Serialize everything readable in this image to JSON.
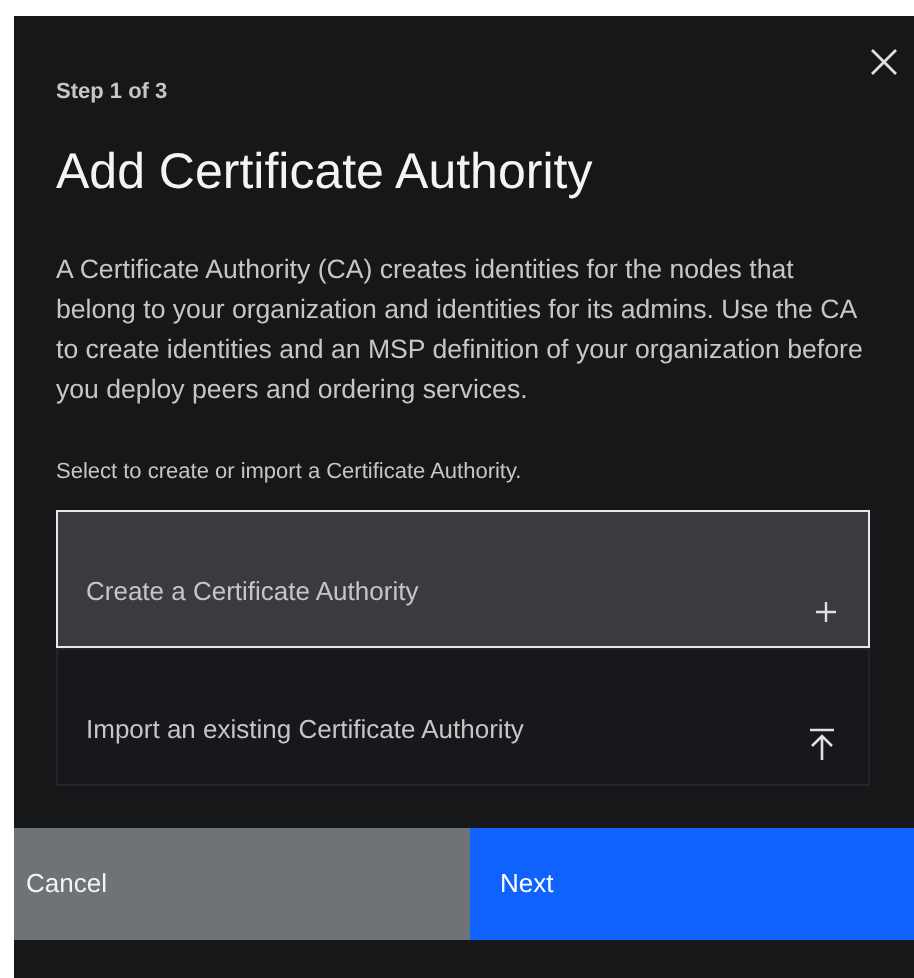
{
  "modal": {
    "step": "Step 1 of 3",
    "title": "Add Certificate Authority",
    "description": "A Certificate Authority (CA) creates identities for the nodes that belong to your organization and identities for its admins. Use the CA to create identities and an MSP definition of your organization before you deploy peers and ordering services.",
    "instruction": "Select to create or import a Certificate Authority.",
    "options": [
      {
        "label": "Create a Certificate Authority",
        "kind": "create",
        "selected": true
      },
      {
        "label": "Import an existing Certificate Authority",
        "kind": "import",
        "selected": false
      }
    ],
    "buttons": [
      {
        "label": "Cancel",
        "kind": "secondary"
      },
      {
        "label": "Next",
        "kind": "primary"
      }
    ]
  }
}
